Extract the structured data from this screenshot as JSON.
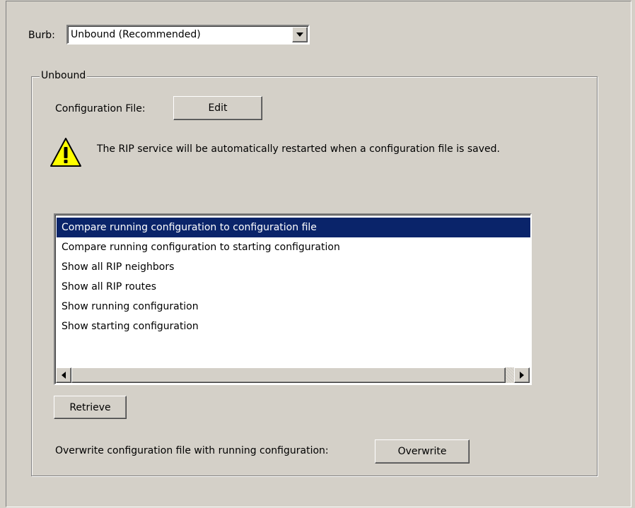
{
  "burb": {
    "label": "Burb:",
    "selected": "Unbound (Recommended)"
  },
  "group": {
    "title": "Unbound",
    "config_file_label": "Configuration File:",
    "edit_label": "Edit",
    "warning_text": "The RIP service will be automatically restarted when a configuration file is saved.",
    "warning_icon": "warning-icon",
    "list": {
      "items": [
        "Compare running configuration to configuration file",
        "Compare running configuration to starting configuration",
        "Show all RIP neighbors",
        "Show all RIP routes",
        "Show running configuration",
        "Show starting configuration"
      ],
      "selected_index": 0
    },
    "retrieve_label": "Retrieve",
    "overwrite_text": "Overwrite configuration file with running configuration:",
    "overwrite_label": "Overwrite"
  },
  "colors": {
    "background": "#d4d0c8",
    "selection": "#0a246a",
    "warning_yellow": "#ffff00"
  }
}
